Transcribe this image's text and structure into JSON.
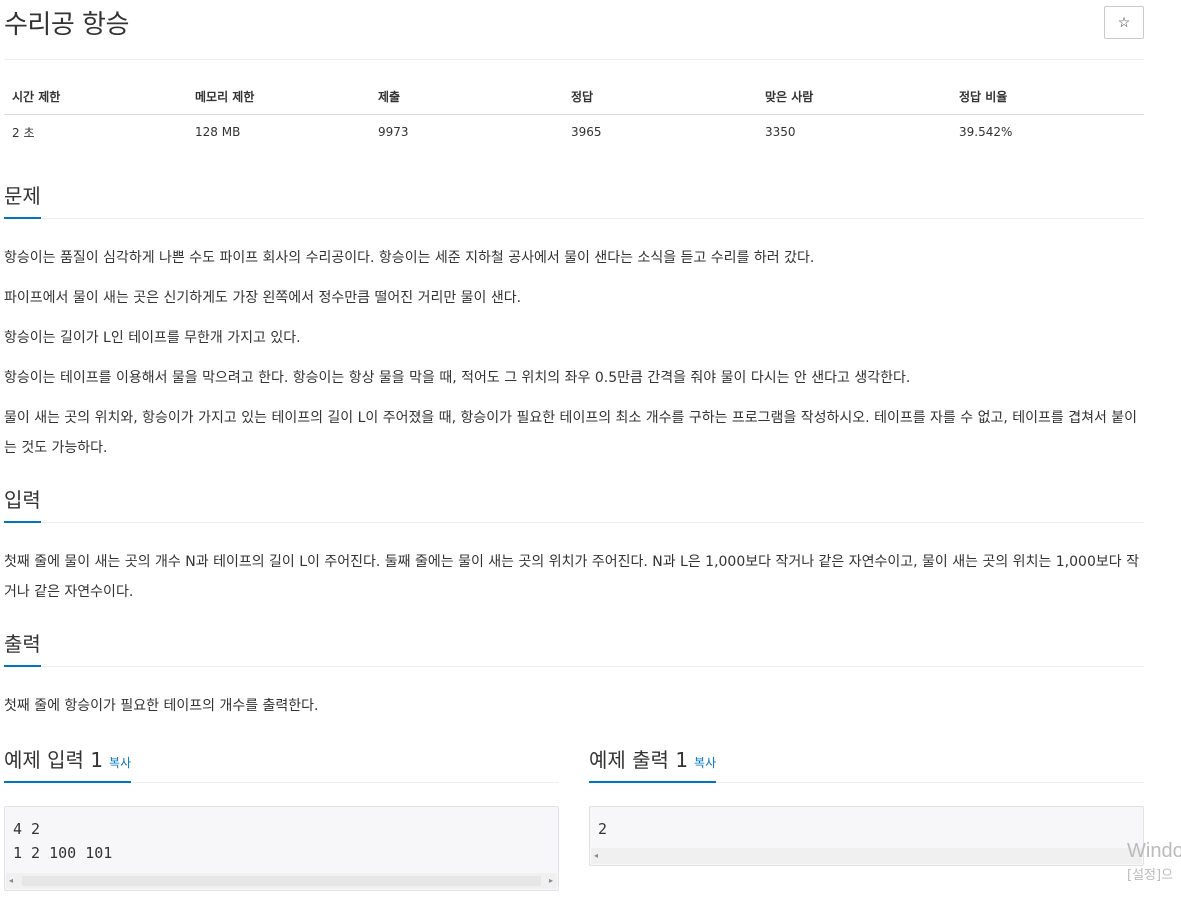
{
  "problem": {
    "title": "수리공 항승",
    "star_icon": "☆"
  },
  "info_table": {
    "headers": [
      "시간 제한",
      "메모리 제한",
      "제출",
      "정답",
      "맞은 사람",
      "정답 비율"
    ],
    "values": [
      "2 초",
      "128 MB",
      "9973",
      "3965",
      "3350",
      "39.542%"
    ]
  },
  "sections": {
    "problem_heading": "문제",
    "problem_paragraphs": [
      "항승이는 품질이 심각하게 나쁜 수도 파이프 회사의 수리공이다. 항승이는 세준 지하철 공사에서 물이 샌다는 소식을 듣고 수리를 하러 갔다.",
      "파이프에서 물이 새는 곳은 신기하게도 가장 왼쪽에서 정수만큼 떨어진 거리만 물이 샌다.",
      "항승이는 길이가 L인 테이프를 무한개 가지고 있다.",
      "항승이는 테이프를 이용해서 물을 막으려고 한다. 항승이는 항상 물을 막을 때, 적어도 그 위치의 좌우 0.5만큼 간격을 줘야 물이 다시는 안 샌다고 생각한다.",
      "물이 새는 곳의 위치와, 항승이가 가지고 있는 테이프의 길이 L이 주어졌을 때, 항승이가 필요한 테이프의 최소 개수를 구하는 프로그램을 작성하시오. 테이프를 자를 수 없고, 테이프를 겹쳐서 붙이는 것도 가능하다."
    ],
    "input_heading": "입력",
    "input_text": "첫째 줄에 물이 새는 곳의 개수 N과 테이프의 길이 L이 주어진다. 둘째 줄에는 물이 새는 곳의 위치가 주어진다. N과 L은 1,000보다 작거나 같은 자연수이고, 물이 새는 곳의 위치는 1,000보다 작거나 같은 자연수이다.",
    "output_heading": "출력",
    "output_text": "첫째 줄에 항승이가 필요한 테이프의 개수를 출력한다."
  },
  "samples": {
    "input_heading": "예제 입력 1",
    "output_heading": "예제 출력 1",
    "copy_label": "복사",
    "input_text": "4 2\n1 2 100 101",
    "output_text": "2"
  },
  "watermark": {
    "line1": "Windo",
    "line2": "[설정]으"
  }
}
